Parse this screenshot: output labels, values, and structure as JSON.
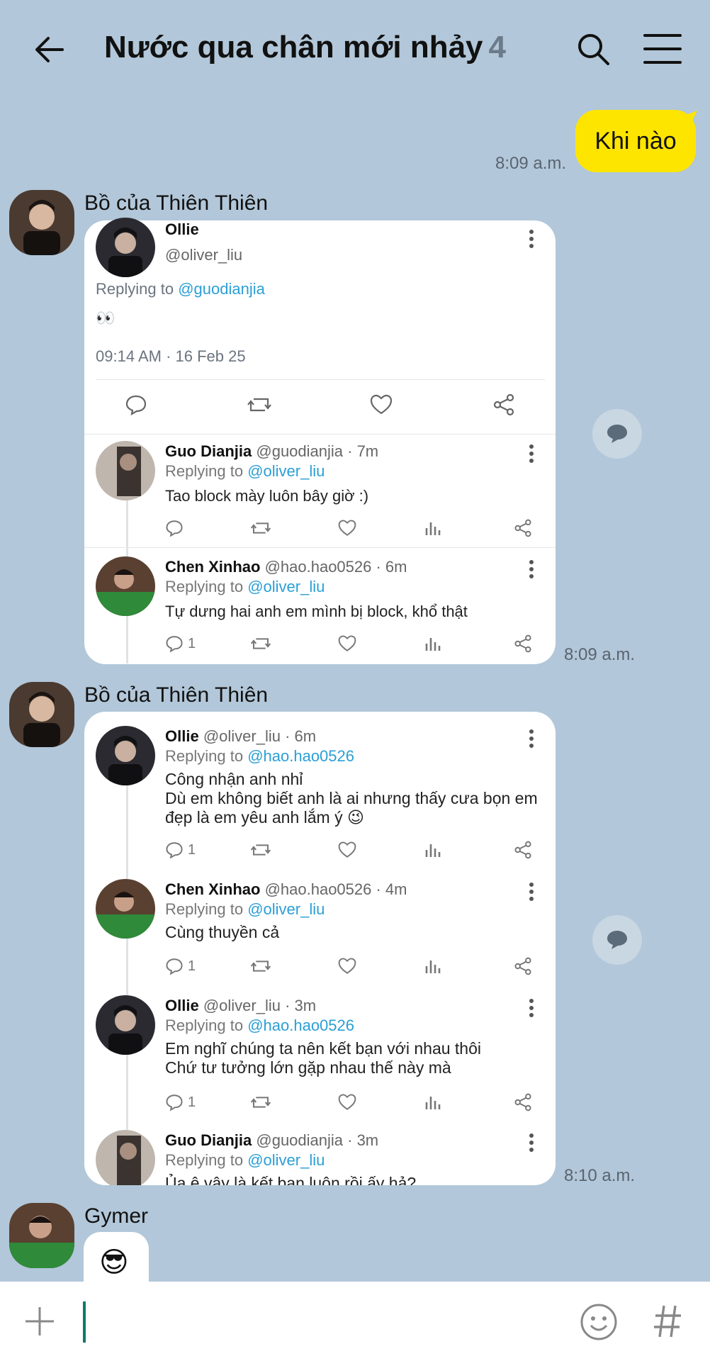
{
  "header": {
    "title": "Nước qua chân mới nhảy",
    "member_count": "4"
  },
  "messages": {
    "mine": {
      "text": "Khi nào",
      "time": "8:09 a.m."
    },
    "group1": {
      "sender": "Bồ của Thiên Thiên",
      "time": "8:09 a.m.",
      "main_tweet": {
        "name": "Ollie",
        "handle": "@oliver_liu",
        "replying_label": "Replying to",
        "replying_to": "@guodianjia",
        "text": "👀",
        "datetime": "09:14 AM · 16 Feb 25"
      },
      "replies": [
        {
          "name": "Guo Dianjia",
          "meta": "@guodianjia · 7m",
          "replying_label": "Replying to",
          "replying_to": "@oliver_liu",
          "text": "Tao block mày luôn bây giờ :)",
          "reply_count": ""
        },
        {
          "name": "Chen Xinhao",
          "meta": "@hao.hao0526 · 6m",
          "replying_label": "Replying to",
          "replying_to": "@oliver_liu",
          "text": "Tự dưng hai anh em mình bị block, khổ thật",
          "reply_count": "1"
        }
      ]
    },
    "group2": {
      "sender": "Bồ của Thiên Thiên",
      "time": "8:10 a.m.",
      "replies": [
        {
          "name": "Ollie",
          "meta": "@oliver_liu · 6m",
          "replying_label": "Replying to",
          "replying_to": "@hao.hao0526",
          "line1": "Công nhận anh nhỉ",
          "line2": "Dù em không biết anh là ai nhưng thấy cưa bọn em",
          "line3": "đẹp là em yêu anh lắm ý 😉",
          "reply_count": "1"
        },
        {
          "name": "Chen Xinhao",
          "meta": "@hao.hao0526 · 4m",
          "replying_label": "Replying to",
          "replying_to": "@oliver_liu",
          "line1": "Cùng thuyền cả",
          "reply_count": "1"
        },
        {
          "name": "Ollie",
          "meta": "@oliver_liu · 3m",
          "replying_label": "Replying to",
          "replying_to": "@hao.hao0526",
          "line1": "Em nghĩ chúng ta nên kết bạn với nhau thôi",
          "line2": "Chứ tư tưởng lớn gặp nhau thế này mà",
          "reply_count": "1"
        },
        {
          "name": "Guo Dianjia",
          "meta": "@guodianjia · 3m",
          "replying_label": "Replying to",
          "replying_to": "@oliver_liu",
          "line1": "Ủa ê vậy là kết bạn luôn rồi ấy hả?"
        }
      ]
    },
    "group3": {
      "sender": "Gymer",
      "text": "😎"
    }
  },
  "input": {
    "placeholder": ""
  },
  "colors": {
    "background": "#b2c7d9",
    "my_bubble": "#fee500",
    "link": "#2b9fd6",
    "cursor": "#0d7a6b"
  }
}
